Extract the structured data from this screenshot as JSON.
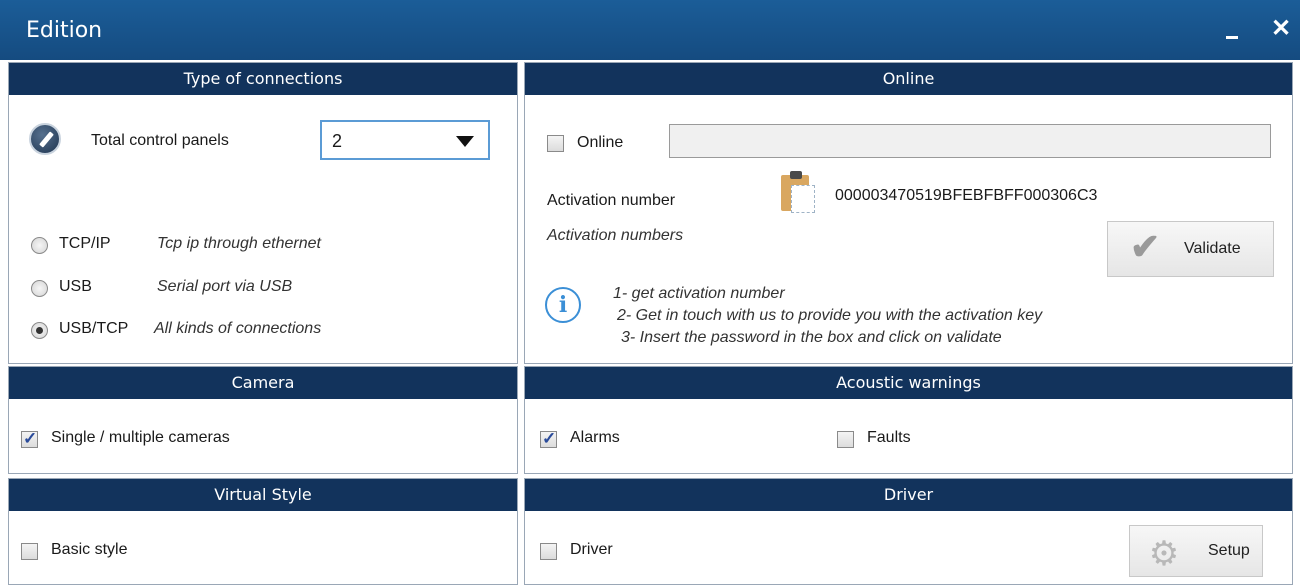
{
  "window": {
    "title": "Edition",
    "minimize_icon": "minimize-icon",
    "close_label": "✕"
  },
  "connections": {
    "header": "Type of connections",
    "total_label": "Total control panels",
    "total_value": "2",
    "options": [
      {
        "name": "TCP/IP",
        "desc": "Tcp ip through ethernet",
        "selected": false
      },
      {
        "name": "USB",
        "desc": "Serial port via USB",
        "selected": false
      },
      {
        "name": "USB/TCP",
        "desc": "All kinds of connections",
        "selected": true
      }
    ]
  },
  "online": {
    "header": "Online",
    "online_label": "Online",
    "online_checked": false,
    "online_value": "",
    "activation_label": "Activation number",
    "activation_value": "000003470519BFEBFBFF000306C3",
    "activation_numbers_label": "Activation numbers",
    "validate_label": "Validate",
    "steps": [
      "1- get activation number",
      "2- Get in touch with us to provide you with the activation key",
      "3- Insert the password in the box and click on validate"
    ]
  },
  "camera": {
    "header": "Camera",
    "label": "Single / multiple cameras",
    "checked": true
  },
  "acoustic": {
    "header": "Acoustic warnings",
    "alarms_label": "Alarms",
    "alarms_checked": true,
    "faults_label": "Faults",
    "faults_checked": false
  },
  "virtual_style": {
    "header": "Virtual Style",
    "label": "Basic style",
    "checked": false
  },
  "driver": {
    "header": "Driver",
    "label": "Driver",
    "checked": false,
    "setup_label": "Setup"
  }
}
